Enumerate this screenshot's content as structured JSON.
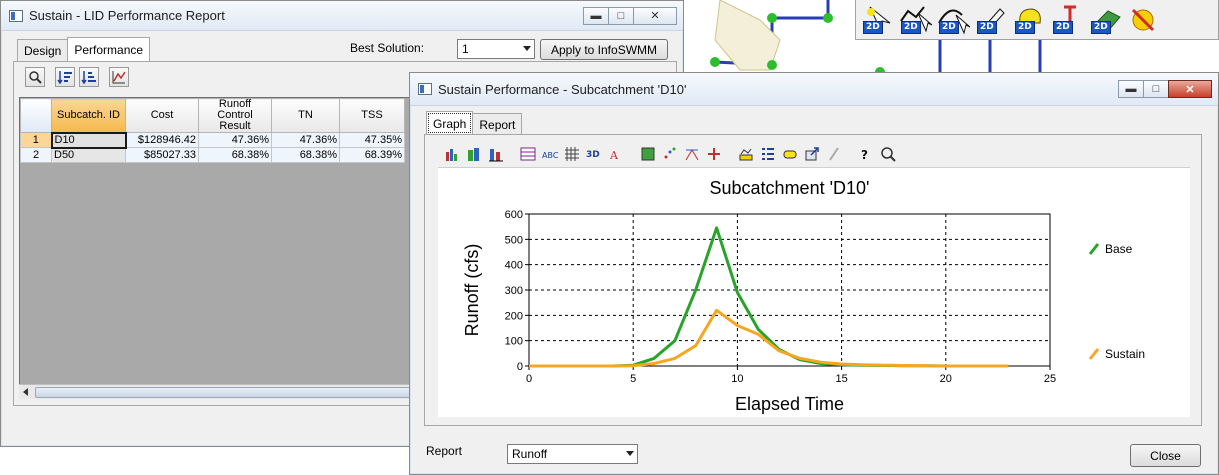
{
  "lid_window": {
    "title": "Sustain - LID Performance Report",
    "tabs": [
      "Design",
      "Performance"
    ],
    "best_solution_label": "Best Solution:",
    "best_solution_value": "1",
    "apply_button": "Apply to InfoSWMM",
    "grid": {
      "columns": [
        "Subcatch. ID",
        "Cost",
        "Runoff Control Result",
        "TN",
        "TSS"
      ],
      "rows": [
        {
          "num": "1",
          "id": "D10",
          "cost": "$128946.42",
          "runoff": "47.36%",
          "tn": "47.36%",
          "tss": "47.35%"
        },
        {
          "num": "2",
          "id": "D50",
          "cost": "$85027.33",
          "runoff": "68.38%",
          "tn": "68.38%",
          "tss": "68.39%"
        }
      ]
    }
  },
  "perf_window": {
    "title": "Sustain Performance - Subcatchment 'D10'",
    "tabs": [
      "Graph",
      "Report"
    ],
    "report_label": "Report",
    "report_value": "Runoff",
    "close_button": "Close"
  },
  "chart_data": {
    "type": "line",
    "title": "Subcatchment 'D10'",
    "xlabel": "Elapsed Time",
    "ylabel": "Runoff (cfs)",
    "xlim": [
      0,
      25
    ],
    "ylim": [
      0,
      600
    ],
    "xticks": [
      0,
      5,
      10,
      15,
      20,
      25
    ],
    "yticks": [
      0,
      100,
      200,
      300,
      400,
      500,
      600
    ],
    "grid": true,
    "legend_position": "right",
    "series": [
      {
        "name": "Base",
        "color": "#2aa32a",
        "x": [
          0,
          1,
          2,
          3,
          4,
          5,
          6,
          7,
          8,
          9,
          10,
          11,
          12,
          13,
          14,
          15,
          16,
          17,
          18,
          19,
          20,
          21,
          22,
          23
        ],
        "y": [
          0,
          0,
          0,
          0,
          0,
          3,
          30,
          100,
          300,
          545,
          290,
          145,
          65,
          25,
          10,
          5,
          3,
          2,
          1,
          1,
          0,
          0,
          0,
          0
        ]
      },
      {
        "name": "Sustain",
        "color": "#f5a623",
        "x": [
          0,
          1,
          2,
          3,
          4,
          5,
          6,
          7,
          8,
          9,
          10,
          11,
          12,
          13,
          14,
          15,
          16,
          17,
          18,
          19,
          20,
          21,
          22,
          23
        ],
        "y": [
          0,
          0,
          0,
          0,
          0,
          1,
          10,
          30,
          80,
          220,
          160,
          125,
          60,
          30,
          15,
          8,
          5,
          3,
          2,
          1,
          0,
          0,
          0,
          0
        ]
      }
    ]
  },
  "icons": {
    "right_toolbar": [
      "select-subarea-2d-icon",
      "node-2d-icon",
      "link-2d-icon",
      "edit-2d-icon",
      "color-2d-icon",
      "height-2d-icon",
      "terrain-2d-icon",
      "delete-icon"
    ],
    "chart_toolbar": [
      "bar-chart-icon",
      "3d-bar-icon",
      "stacked-bar-icon",
      "data-table-icon",
      "abc-text-icon",
      "grid-lines-icon",
      "3d-view-icon",
      "font-icon",
      "pattern-icon",
      "scatter-icon",
      "axis-icon",
      "point-icon",
      "title-icon",
      "legend-icon",
      "label-icon",
      "export-icon",
      "pen-icon",
      "help-icon",
      "zoom-icon"
    ]
  }
}
